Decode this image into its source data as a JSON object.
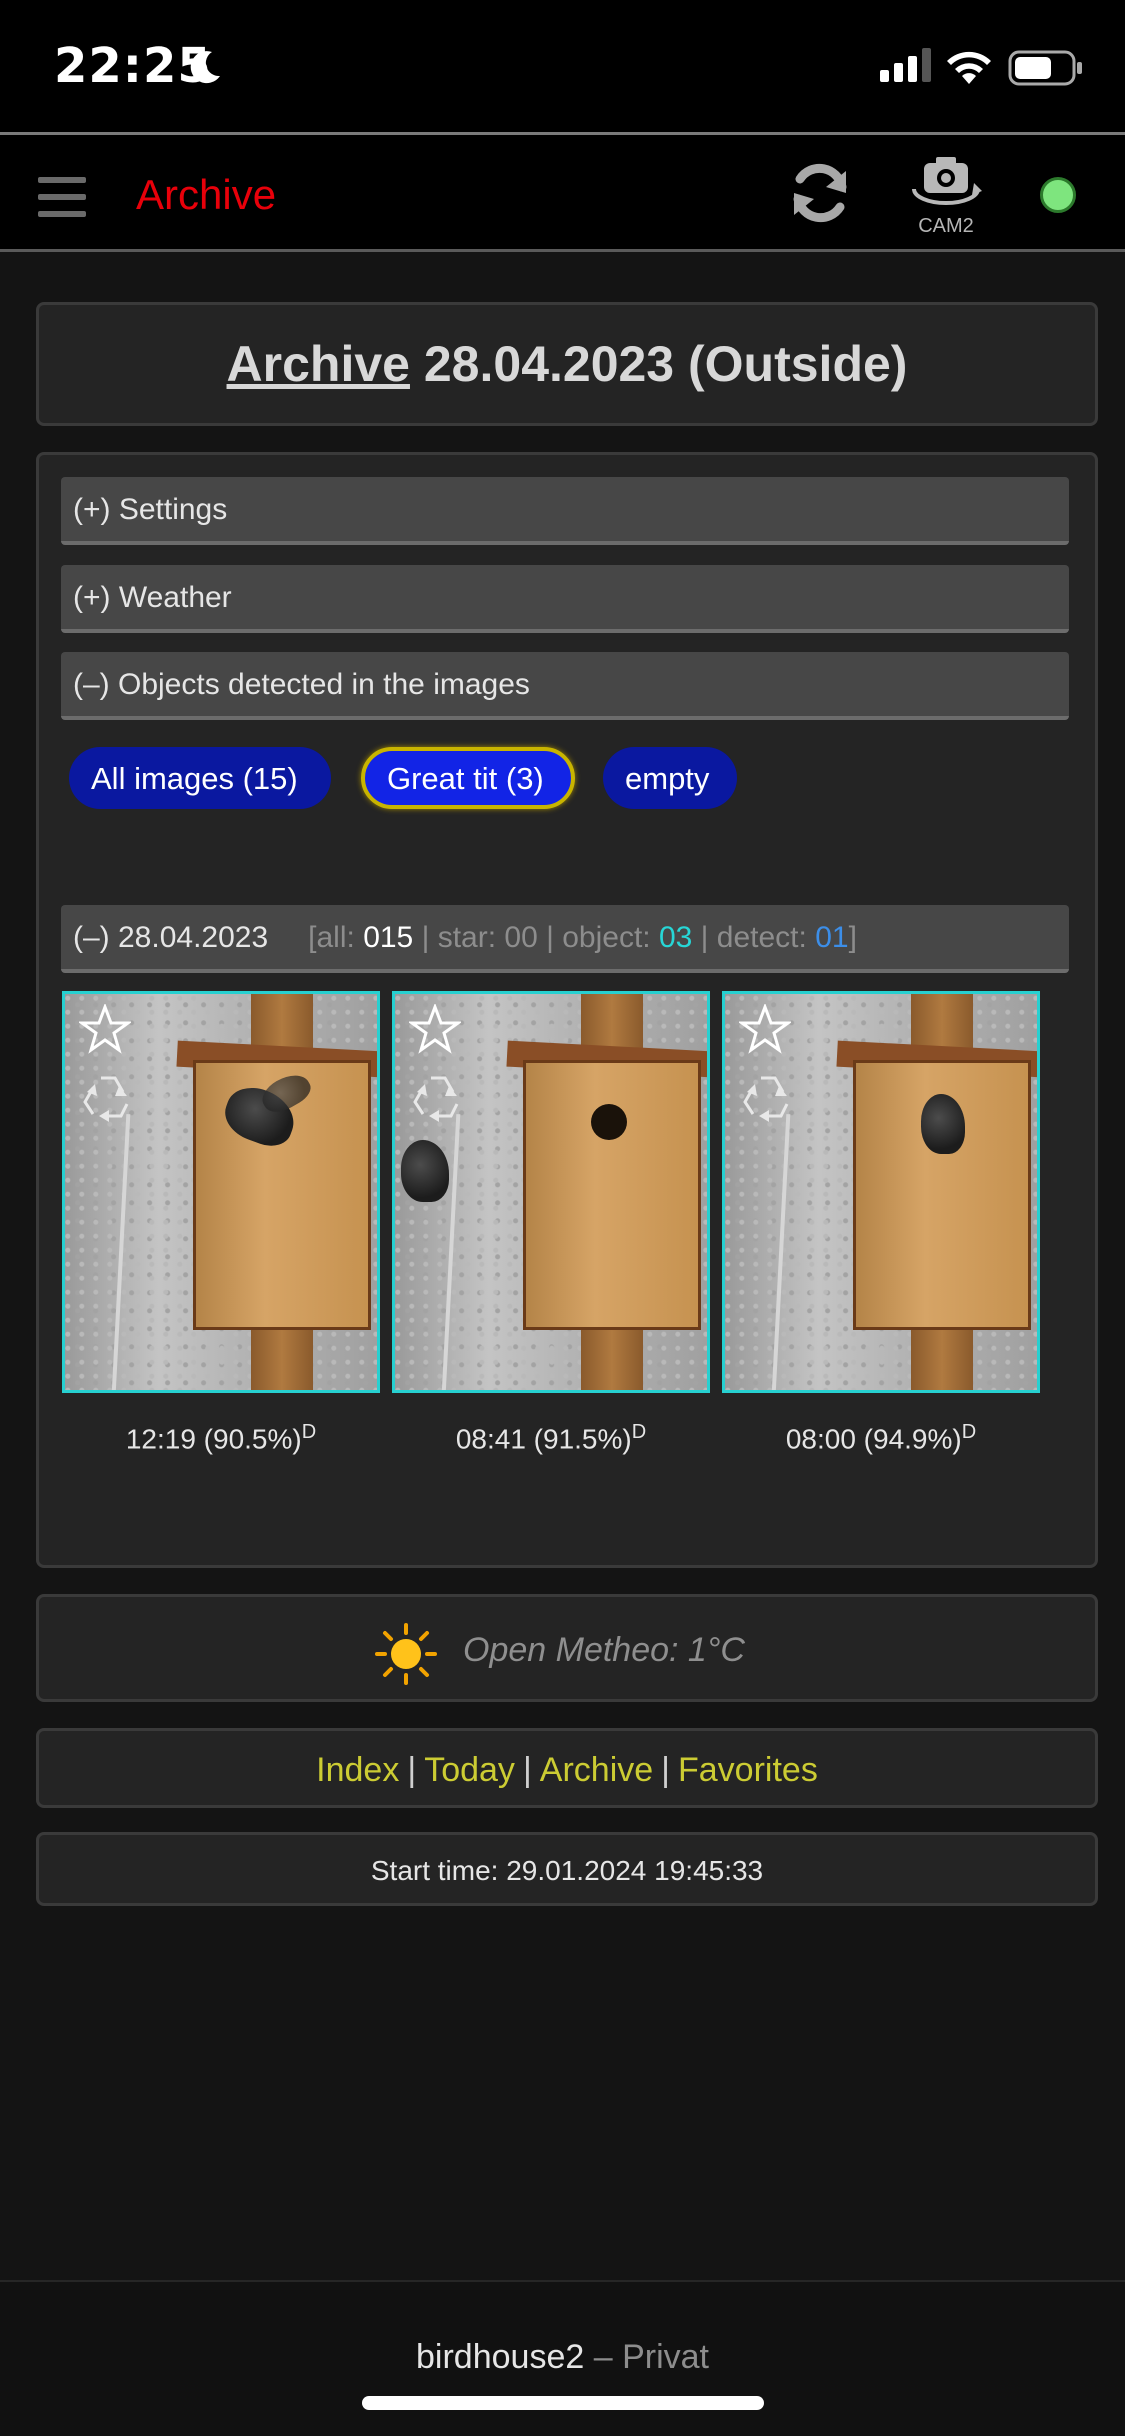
{
  "status_bar": {
    "time": "22:25",
    "icons": [
      "moon-icon",
      "signal-icon",
      "wifi-icon",
      "battery-icon"
    ]
  },
  "header": {
    "title": "Archive",
    "camera_label": "CAM2",
    "status_color": "#7ee57e",
    "icons": [
      "menu-icon",
      "reload-icon",
      "camera-switch-icon"
    ]
  },
  "page": {
    "title_link": "Archive",
    "title_rest": "28.04.2023 (Outside)"
  },
  "sections": {
    "settings": "(+) Settings",
    "weather": "(+) Weather",
    "objects": "(–) Objects detected in the images"
  },
  "filters": [
    {
      "label": "All images (15)"
    },
    {
      "label": "Great tit (3)",
      "active": true
    },
    {
      "label": "empty"
    }
  ],
  "day_group": {
    "label": "(–) 28.04.2023",
    "all_label": "[all: ",
    "all": "015",
    "star_label": " | star: 00 | object: ",
    "object": "03",
    "detect_label": " | detect: ",
    "detect": "01",
    "close": "]"
  },
  "images": [
    {
      "time": "12:19 (90.5%)",
      "flag": "D"
    },
    {
      "time": "08:41 (91.5%)",
      "flag": "D"
    },
    {
      "time": "08:00 (94.9%)",
      "flag": "D"
    }
  ],
  "weather": {
    "icon": "sun-icon",
    "text": "Open Metheo: 1°C"
  },
  "nav": {
    "index": "Index",
    "today": "Today",
    "archive": "Archive",
    "favorites": "Favorites",
    "separator": "|"
  },
  "start_time": "Start time: 29.01.2024 19:45:33",
  "footer": {
    "name": "birdhouse2",
    "suffix": "– Privat"
  },
  "colors": {
    "accent_red": "#e8000a",
    "chip_blue": "#0a18a0",
    "chip_active": "#1224e6",
    "chip_active_border": "#c8b400",
    "thumb_border": "#27d0d0",
    "nav_link": "#cccc33",
    "object_count": "#27d6d6",
    "detect_count": "#3c8ee8"
  }
}
